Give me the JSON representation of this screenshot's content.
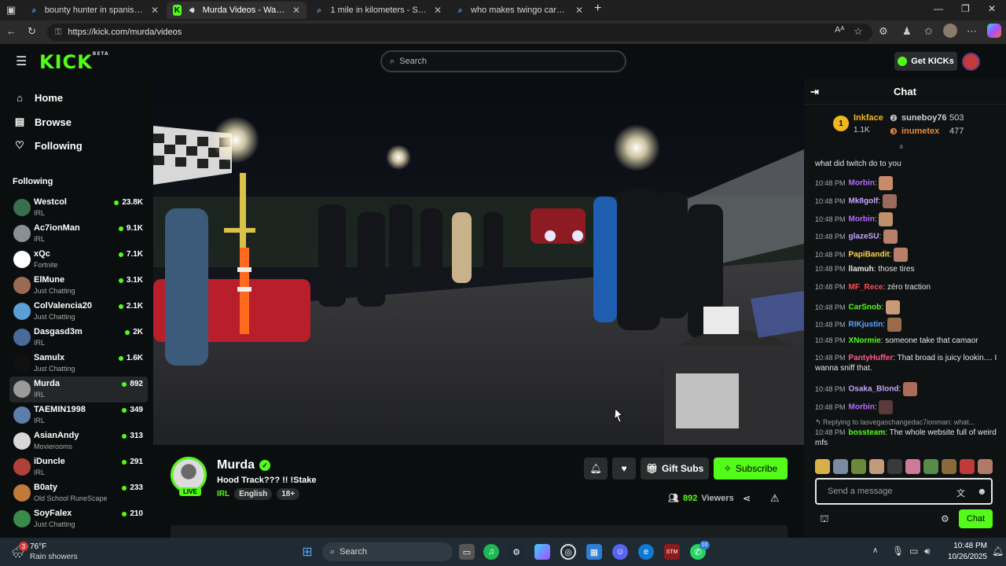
{
  "browser": {
    "tabs": [
      {
        "title": "bounty hunter in spanish - Search",
        "active": false
      },
      {
        "title": "Murda Videos - Watch On-D",
        "active": true
      },
      {
        "title": "1 mile in kilometers - Search",
        "active": false
      },
      {
        "title": "who makes twingo cars - Search",
        "active": false
      }
    ],
    "url": "https://kick.com/murda/videos"
  },
  "kick": {
    "logo": "KICK",
    "logo_badge": "BETA",
    "search_placeholder": "Search",
    "get_kicks": "Get KICKs"
  },
  "sidebar": {
    "nav": [
      {
        "label": "Home",
        "icon": "home-icon"
      },
      {
        "label": "Browse",
        "icon": "browse-icon"
      },
      {
        "label": "Following",
        "icon": "heart-icon"
      }
    ],
    "following_title": "Following",
    "channels": [
      {
        "name": "Westcol",
        "category": "IRL",
        "viewers": "23.8K",
        "color": "#3b6e4c"
      },
      {
        "name": "Ac7ionMan",
        "category": "IRL",
        "viewers": "9.1K",
        "color": "#8a8f96"
      },
      {
        "name": "xQc",
        "category": "Fortnite",
        "viewers": "7.1K",
        "color": "#ffffff"
      },
      {
        "name": "ElMune",
        "category": "Just Chatting",
        "viewers": "3.1K",
        "color": "#9a6b52"
      },
      {
        "name": "ColValencia20",
        "category": "Just Chatting",
        "viewers": "2.1K",
        "color": "#5a9fd6"
      },
      {
        "name": "Dasgasd3m",
        "category": "IRL",
        "viewers": "2K",
        "color": "#4a6a9a"
      },
      {
        "name": "Samulx",
        "category": "Just Chatting",
        "viewers": "1.6K",
        "color": "#111111"
      },
      {
        "name": "Murda",
        "category": "IRL",
        "viewers": "892",
        "color": "#9b9b9b"
      },
      {
        "name": "TAEMIN1998",
        "category": "IRL",
        "viewers": "349",
        "color": "#5b7fa6"
      },
      {
        "name": "AsianAndy",
        "category": "Movierooms",
        "viewers": "313",
        "color": "#d8d8d8"
      },
      {
        "name": "iDuncle",
        "category": "IRL",
        "viewers": "291",
        "color": "#b0403a"
      },
      {
        "name": "B0aty",
        "category": "Old School RuneScape",
        "viewers": "233",
        "color": "#c27a3a"
      },
      {
        "name": "SoyFalex",
        "category": "Just Chatting",
        "viewers": "210",
        "color": "#3a8a4a"
      }
    ],
    "selected_index": 7
  },
  "stream": {
    "channel": "Murda",
    "title": "Hood Track??? !! !Stake",
    "live_label": "LIVE",
    "category": "IRL",
    "tags": [
      "English",
      "18+"
    ],
    "gift_label": "Gift Subs",
    "subscribe_label": "Subscribe",
    "viewers": "892",
    "viewers_label": "Viewers"
  },
  "chat": {
    "title": "Chat",
    "leaderboard": {
      "first": {
        "name": "Inkface",
        "count": "1.1K"
      },
      "second": {
        "name": "suneboy76",
        "count": "503"
      },
      "third": {
        "name": "inumetex",
        "count": "477"
      }
    },
    "messages": [
      {
        "time": "",
        "user": "",
        "text": "what did twitch do to you",
        "color": "#e6e6e6"
      },
      {
        "time": "10:48 PM",
        "user": "Morbin",
        "text": "",
        "color": "#b56cff"
      },
      {
        "time": "10:48 PM",
        "user": "Mk8golf",
        "text": "",
        "color": "#c6a4ff"
      },
      {
        "time": "10:48 PM",
        "user": "Morbin",
        "text": "",
        "color": "#b56cff"
      },
      {
        "time": "10:48 PM",
        "user": "glazeSU",
        "text": "",
        "color": "#c6a4ff"
      },
      {
        "time": "10:48 PM",
        "user": "PapiBandit",
        "text": "",
        "color": "#ffd24a"
      },
      {
        "time": "10:48 PM",
        "user": "llamuh",
        "text": "those tires",
        "color": "#e6e6e6"
      },
      {
        "time": "10:48 PM",
        "user": "MF_Rece",
        "text": "zéro traction",
        "color": "#ff4d4d"
      },
      {
        "time": "10:48 PM",
        "user": "CarSnob",
        "text": "",
        "color": "#53fc18"
      },
      {
        "time": "10:48 PM",
        "user": "RIKjustin",
        "text": "",
        "color": "#5aa8ff"
      },
      {
        "time": "10:48 PM",
        "user": "XNormie",
        "text": "someone take that camaor",
        "color": "#53fc18"
      },
      {
        "time": "10:48 PM",
        "user": "PantyHuffer",
        "text": "That broad is juicy lookin.... I wanna sniff that.",
        "color": "#ff5c8a"
      },
      {
        "time": "10:48 PM",
        "user": "Osaka_Blond",
        "text": "",
        "color": "#c6a4ff"
      },
      {
        "time": "10:48 PM",
        "user": "Morbin",
        "text": "",
        "color": "#b56cff"
      },
      {
        "time": "10:48 PM",
        "user": "bossteam",
        "text": "The whole website full of weird mfs",
        "color": "#53fc18"
      }
    ],
    "reply_context": "Replying to lasvegaschangedac7ionman: what...",
    "input_placeholder": "Send a message",
    "send_label": "Chat"
  },
  "taskbar": {
    "weather_temp": "76°F",
    "weather_desc": "Rain showers",
    "weather_badge": "3",
    "search_label": "Search",
    "time": "10:48 PM",
    "date": "10/26/2025",
    "whatsapp_badge": "10"
  }
}
